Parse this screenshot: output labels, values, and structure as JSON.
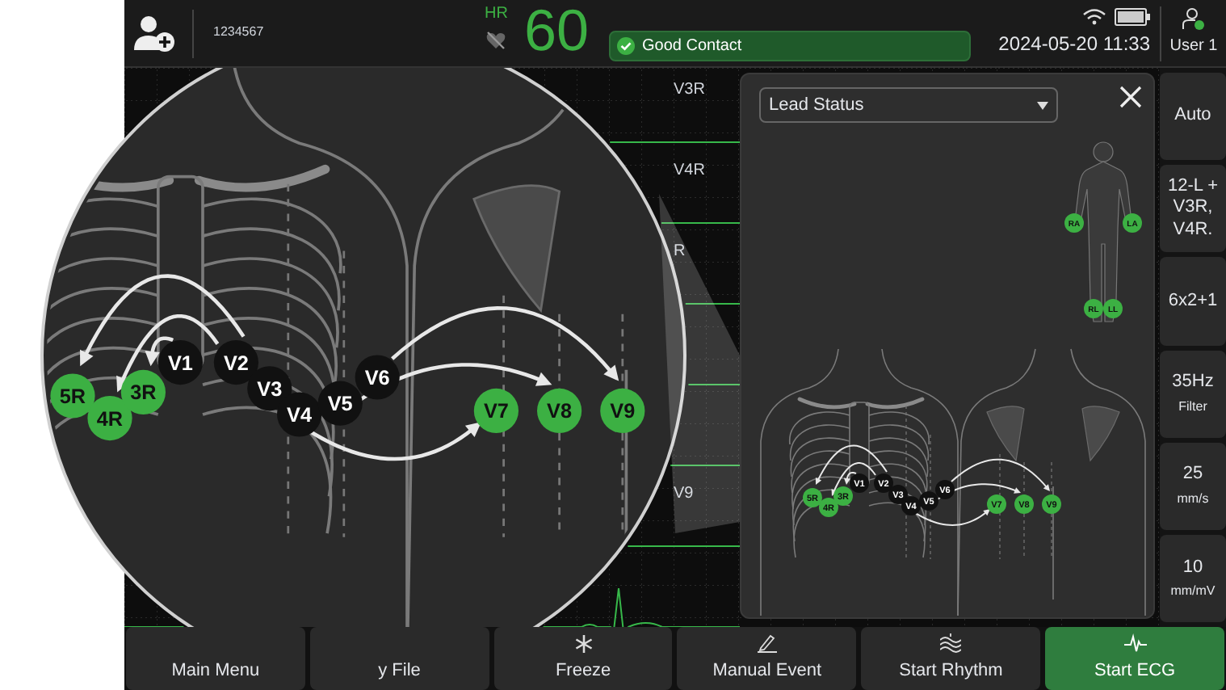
{
  "top_bar": {
    "patient_id": "1234567",
    "hr_label": "HR",
    "hr_value": "60",
    "contact_status": "Good Contact",
    "datetime": "2024-05-20 11:33",
    "user": "User 1"
  },
  "ecg": {
    "leads": [
      {
        "label": "V3R"
      },
      {
        "label": "V4R"
      },
      {
        "label": "R"
      },
      {
        "label": "V9"
      }
    ]
  },
  "magnifier": {
    "electrodes": [
      {
        "label": "5R",
        "color": "#3cb043"
      },
      {
        "label": "4R",
        "color": "#3cb043"
      },
      {
        "label": "3R",
        "color": "#3cb043"
      },
      {
        "label": "V1",
        "color": "#111111"
      },
      {
        "label": "V2",
        "color": "#111111"
      },
      {
        "label": "V3",
        "color": "#111111"
      },
      {
        "label": "V4",
        "color": "#111111"
      },
      {
        "label": "V5",
        "color": "#111111"
      },
      {
        "label": "V6",
        "color": "#111111"
      },
      {
        "label": "V7",
        "color": "#3cb043"
      },
      {
        "label": "V8",
        "color": "#3cb043"
      },
      {
        "label": "V9",
        "color": "#3cb043"
      }
    ]
  },
  "lead_panel": {
    "dropdown": {
      "value": "Lead Status"
    },
    "limb_electrodes": [
      {
        "label": "RA",
        "color": "#3cb043"
      },
      {
        "label": "LA",
        "color": "#3cb043"
      },
      {
        "label": "RL",
        "color": "#3cb043"
      },
      {
        "label": "LL",
        "color": "#3cb043"
      }
    ],
    "chest_electrodes": [
      {
        "label": "5R",
        "color": "#3cb043"
      },
      {
        "label": "4R",
        "color": "#3cb043"
      },
      {
        "label": "3R",
        "color": "#3cb043"
      },
      {
        "label": "V1",
        "color": "#111111"
      },
      {
        "label": "V2",
        "color": "#111111"
      },
      {
        "label": "V3",
        "color": "#111111"
      },
      {
        "label": "V4",
        "color": "#111111"
      },
      {
        "label": "V5",
        "color": "#111111"
      },
      {
        "label": "V6",
        "color": "#111111"
      },
      {
        "label": "V7",
        "color": "#3cb043"
      },
      {
        "label": "V8",
        "color": "#3cb043"
      },
      {
        "label": "V9",
        "color": "#3cb043"
      }
    ]
  },
  "side_buttons": [
    {
      "label": "Auto"
    },
    {
      "label": "12-L + V3R, V4R."
    },
    {
      "label": "6x2+1"
    },
    {
      "label": "35Hz",
      "sublabel": "Filter"
    },
    {
      "label": "25",
      "sublabel": "mm/s"
    },
    {
      "label": "10",
      "sublabel": "mm/mV"
    }
  ],
  "bottom_buttons": [
    {
      "label": "Main Menu",
      "kind": "default"
    },
    {
      "label": "y File",
      "kind": "default"
    },
    {
      "label": "Freeze",
      "kind": "default"
    },
    {
      "label": "Manual Event",
      "kind": "default"
    },
    {
      "label": "Start Rhythm",
      "kind": "default"
    },
    {
      "label": "Start ECG",
      "kind": "primary"
    }
  ]
}
